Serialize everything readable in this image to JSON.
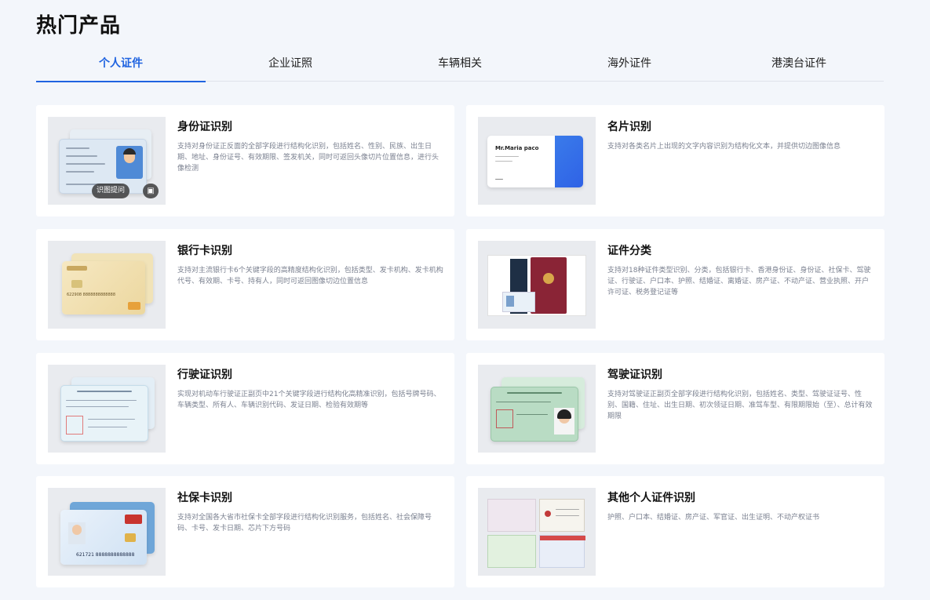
{
  "page": {
    "title": "热门产品"
  },
  "tabs": [
    {
      "label": "个人证件",
      "active": true
    },
    {
      "label": "企业证照",
      "active": false
    },
    {
      "label": "车辆相关",
      "active": false
    },
    {
      "label": "海外证件",
      "active": false
    },
    {
      "label": "港澳台证件",
      "active": false
    }
  ],
  "cards": [
    {
      "title": "身份证识别",
      "desc": "支持对身份证正反面的全部字段进行结构化识别，包括姓名、性别、民族、出生日期、地址、身份证号、有效期限、签发机关，同时可返回头像切片位置信息，进行头像检测",
      "overlay": "识图提问"
    },
    {
      "title": "名片识别",
      "desc": "支持对各类名片上出现的文字内容识别为结构化文本，并提供切边图像信息",
      "card_name": "Mr.Maria paco"
    },
    {
      "title": "银行卡识别",
      "desc": "支持对主流银行卡6个关键字段的高精度结构化识别，包括类型、发卡机构、发卡机构代号、有效期、卡号、持有人，同时可返回图像切边位置信息",
      "card_number": "622908 8888888888888"
    },
    {
      "title": "证件分类",
      "desc": "支持对18种证件类型识别、分类，包括银行卡、香港身份证、身份证、社保卡、驾驶证、行驶证、户口本、护照、结婚证、离婚证、房产证、不动产证、营业执照、开户许可证、税务登记证等"
    },
    {
      "title": "行驶证识别",
      "desc": "实现对机动车行驶证正副页中21个关键字段进行结构化高精准识别，包括号牌号码、车辆类型、所有人、车辆识别代码、发证日期、检验有效期等"
    },
    {
      "title": "驾驶证识别",
      "desc": "支持对驾驶证正副页全部字段进行结构化识别，包括姓名、类型、驾驶证证号、性别、国籍、住址、出生日期、初次领证日期、准驾车型、有限期限始（至）、总计有效期限"
    },
    {
      "title": "社保卡识别",
      "desc": "支持对全国各大省市社保卡全部字段进行结构化识别服务，包括姓名、社会保障号码、卡号、发卡日期、芯片下方号码",
      "card_number": "621721 8888888888888"
    },
    {
      "title": "其他个人证件识别",
      "desc": "护照、户口本、结婚证、房产证、军官证、出生证明、不动产权证书"
    }
  ],
  "colors": {
    "accent": "#1f63e0",
    "background": "#f3f6fb"
  }
}
